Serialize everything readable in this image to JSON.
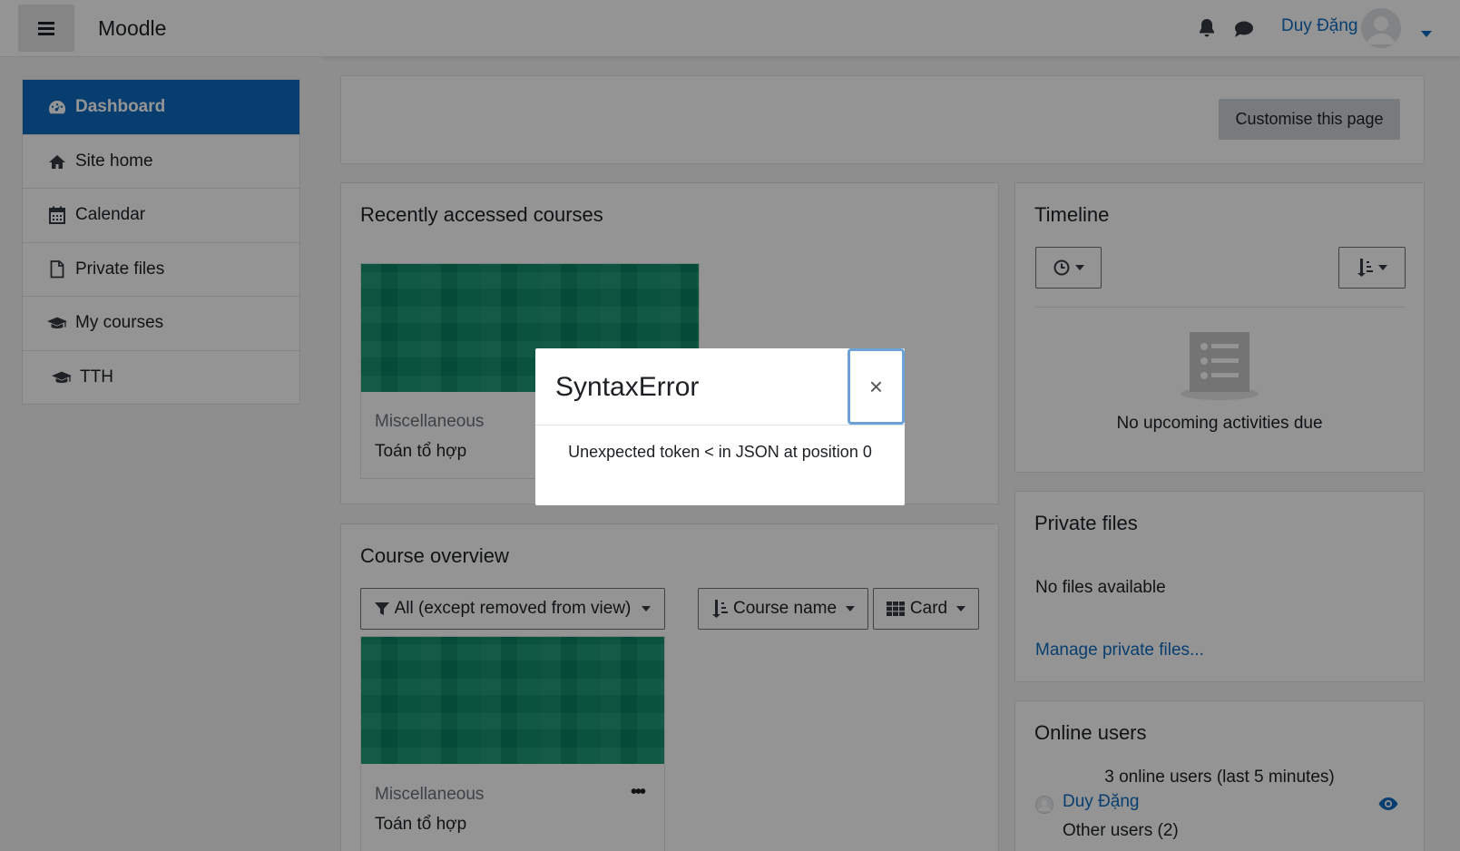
{
  "navbar": {
    "brand": "Moodle",
    "username": "Duy Đặng"
  },
  "sidebar": {
    "items": [
      {
        "label": "Dashboard",
        "icon": "dashboard-icon",
        "active": true
      },
      {
        "label": "Site home",
        "icon": "home-icon"
      },
      {
        "label": "Calendar",
        "icon": "calendar-icon"
      },
      {
        "label": "Private files",
        "icon": "file-icon"
      },
      {
        "label": "My courses",
        "icon": "graduation-cap-icon"
      },
      {
        "label": "TTH",
        "icon": "graduation-cap-icon"
      }
    ]
  },
  "main": {
    "customise_button": "Customise this page",
    "recent": {
      "title": "Recently accessed courses",
      "course": {
        "category": "Miscellaneous",
        "name": "Toán tổ hợp"
      }
    },
    "overview": {
      "title": "Course overview",
      "filter_label": "All (except removed from view)",
      "sort_label": "Course name",
      "view_label": "Card",
      "course": {
        "category": "Miscellaneous",
        "name": "Toán tổ hợp"
      }
    }
  },
  "right": {
    "timeline": {
      "title": "Timeline",
      "empty_text": "No upcoming activities due"
    },
    "private_files": {
      "title": "Private files",
      "empty_text": "No files available",
      "manage_link": "Manage private files..."
    },
    "online_users": {
      "title": "Online users",
      "summary": "3 online users (last 5 minutes)",
      "user": "Duy Đặng",
      "others": "Other users (2)"
    }
  },
  "modal": {
    "title": "SyntaxError",
    "close_symbol": "×",
    "message": "Unexpected token < in JSON at position 0"
  },
  "colors": {
    "primary": "#0f6cbf",
    "course_image": "#0b8f6c"
  }
}
